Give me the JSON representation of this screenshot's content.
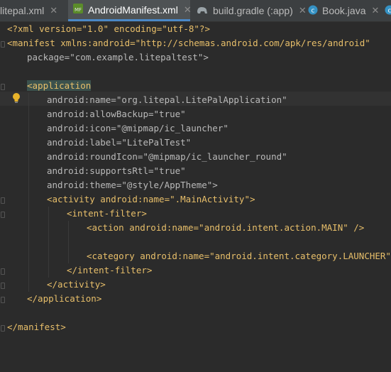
{
  "tabs": [
    {
      "label": "litepal.xml",
      "icon": "xml-file-icon",
      "active": false
    },
    {
      "label": "AndroidManifest.xml",
      "icon": "manifest-file-icon",
      "active": true
    },
    {
      "label": "build.gradle (:app)",
      "icon": "gradle-elephant-icon",
      "active": false
    },
    {
      "label": "Book.java",
      "icon": "java-class-icon",
      "active": false
    }
  ],
  "code": {
    "xml_decl": "<?xml version=\"1.0\" encoding=\"utf-8\"?>",
    "manifest_open": "<manifest xmlns:android=\"http://schemas.android.com/apk/res/android\"",
    "package_line": "package=\"com.example.litepaltest\">",
    "application_open": "<application",
    "attrs": [
      "android:name=\"org.litepal.LitePalApplication\"",
      "android:allowBackup=\"true\"",
      "android:icon=\"@mipmap/ic_launcher\"",
      "android:label=\"LitePalTest\"",
      "android:roundIcon=\"@mipmap/ic_launcher_round\"",
      "android:supportsRtl=\"true\"",
      "android:theme=\"@style/AppTheme\">"
    ],
    "activity_open": "<activity android:name=\".MainActivity\">",
    "intent_filter_open": "<intent-filter>",
    "action_line": "<action android:name=\"android.intent.action.MAIN\" />",
    "category_line": "<category android:name=\"android.intent.category.LAUNCHER\" />",
    "intent_filter_close": "</intent-filter>",
    "activity_close": "</activity>",
    "application_close": "</application>",
    "manifest_close": "</manifest>"
  },
  "colors": {
    "editor_bg": "#2b2b2b",
    "tag": "#e8bf6a",
    "namespace": "#9876aa",
    "attribute": "#bababa",
    "string": "#6a8759",
    "active_tab_underline": "#4a88c7"
  }
}
